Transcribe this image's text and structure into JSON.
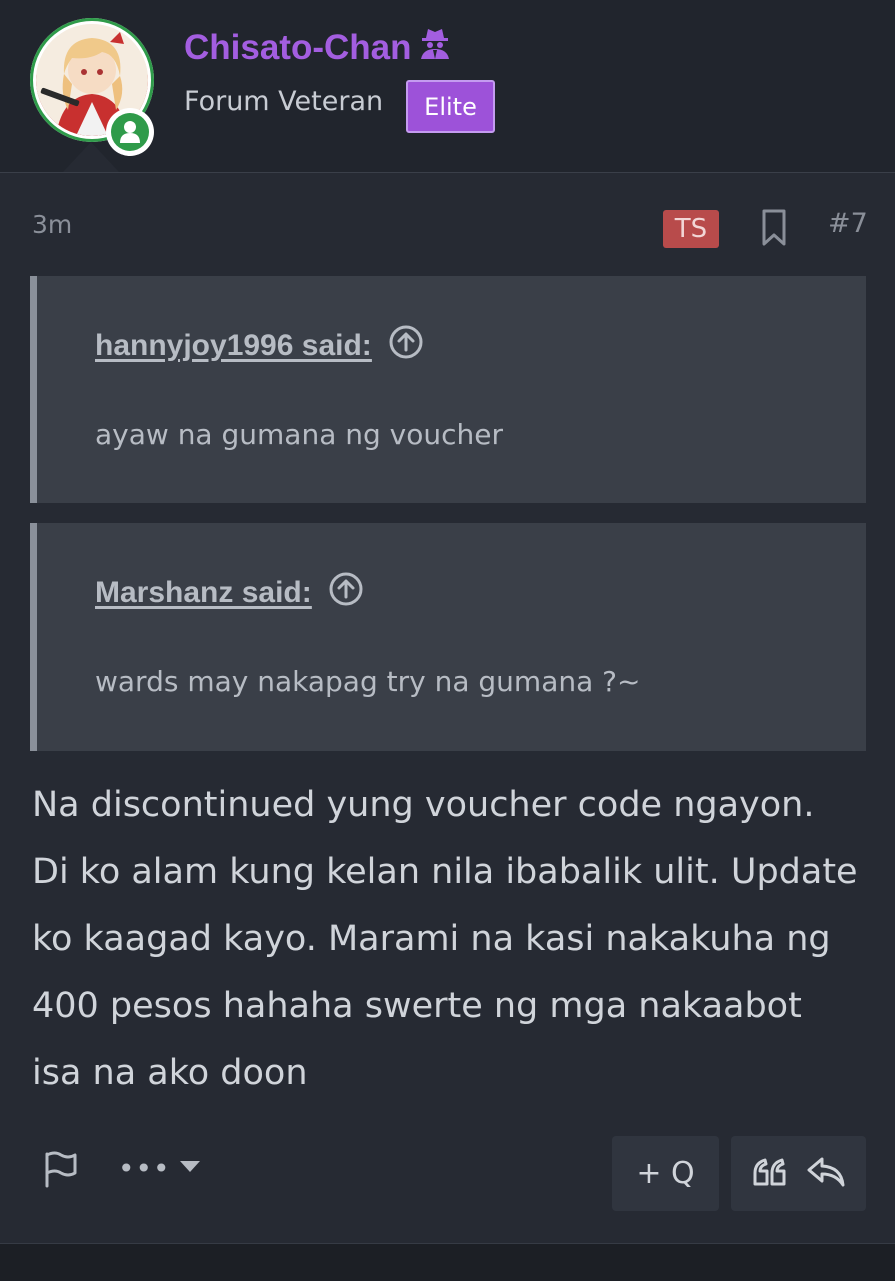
{
  "author": {
    "username": "Chisato-Chan",
    "user_title": "Forum Veteran",
    "banner": "Elite",
    "online_icon": "user-online-icon",
    "spy_icon": "user-secret-icon"
  },
  "post": {
    "time": "3m",
    "ts_badge": "TS",
    "number": "#7",
    "quotes": [
      {
        "author_label": "hannyjoy1996 said:",
        "text": "ayaw na gumana ng voucher"
      },
      {
        "author_label": "Marshanz said:",
        "text": "wards may nakapag try na gumana ?~"
      }
    ],
    "body_lines": [
      "Na discontinued yung voucher code ngayon.",
      "Di ko alam kung kelan nila ibabalik ulit. Update",
      "ko kaagad kayo. Marami na kasi nakakuha ng",
      "400 pesos hahaha swerte ng mga nakaabot",
      "isa na ako doon"
    ]
  },
  "actions": {
    "report_icon": "flag-icon",
    "more_dots": "•••",
    "multiquote_label": "+ Q",
    "quote_icon": "quote-icon",
    "reply_icon": "reply-icon"
  },
  "colors": {
    "username": "#a35ee0",
    "banner": "#9d52d9",
    "ts_badge": "#b84b4b",
    "online": "#2f9b4a"
  }
}
